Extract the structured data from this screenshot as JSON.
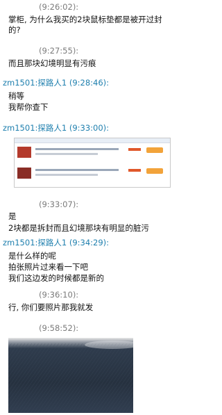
{
  "messages": [
    {
      "time": "(9:26:02):",
      "lines": [
        "掌柜, 为什么我买的2块鼠标垫都是被开过封",
        "的?"
      ]
    },
    {
      "time": "(9:27:55):",
      "lines": [
        "而且那块幻境明显有污痕"
      ]
    },
    {
      "nick": "zm1501:探路人1",
      "time": "(9:28:46):",
      "lines": [
        "稍等",
        "我帮你查下"
      ]
    },
    {
      "nick": "zm1501:探路人1",
      "time": "(9:33:00):",
      "attachment": "screenshot"
    },
    {
      "time": "(9:33:07):",
      "lines": [
        "是",
        "2块都是拆封而且幻境那块有明显的脏污"
      ]
    },
    {
      "nick": "zm1501:探路人1",
      "time": "(9:34:29):",
      "lines": [
        "是什么样的呢",
        "拍张照片过来看一下吧",
        "我们这边发的时候都是新的"
      ]
    },
    {
      "time": "(9:36:10):",
      "lines": [
        "行, 你们要照片那我就发"
      ]
    },
    {
      "time": "(9:58:52):",
      "attachment": "photo"
    }
  ]
}
